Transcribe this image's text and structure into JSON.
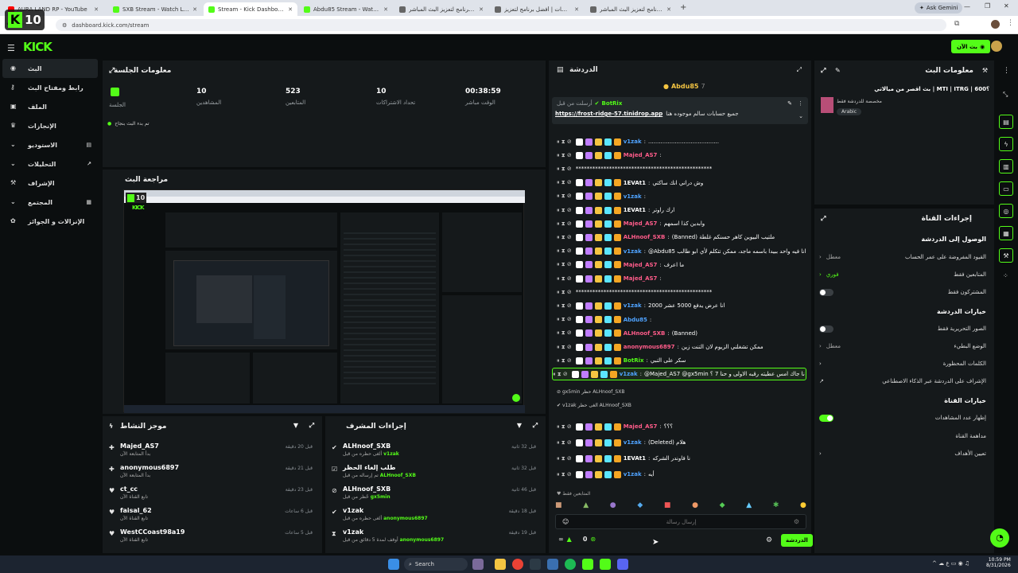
{
  "browser": {
    "tabs": [
      {
        "title": "AURA LAND RP - YouTube",
        "color": "#ff0000"
      },
      {
        "title": "SXB Stream - Watch Live on Kick",
        "color": "#53fc18"
      },
      {
        "title": "Stream - Kick Dashboard",
        "color": "#53fc18"
      },
      {
        "title": "Abdu85 Stream - Watch Live on Kick",
        "color": "#53fc18"
      },
      {
        "title": "أفضل برنامج لتعزيز البث المباشر",
        "color": "#666666"
      },
      {
        "title": "الوسيطات | أفضل برنامج لتعزيز",
        "color": "#666666"
      },
      {
        "title": "أفضل برنامج لتعزيز البث المباشر",
        "color": "#666666"
      }
    ],
    "new_tab": "+",
    "ask_gemini": "Ask Gemini",
    "url": "dashboard.kick.com/stream"
  },
  "topbar": {
    "logo": "KICK",
    "live_button": "بث الآن",
    "overlay_badge": "10"
  },
  "sidebar": {
    "items": [
      {
        "label": "البث",
        "icon": "broadcast-icon"
      },
      {
        "label": "رابط ومفتاح البث",
        "icon": "key-icon"
      },
      {
        "label": "الملف",
        "icon": "profile-icon"
      },
      {
        "label": "الإنجازات",
        "icon": "trophy-icon"
      },
      {
        "label": "الاستوديو",
        "icon": "studio-icon"
      },
      {
        "label": "التحليلات",
        "icon": "analytics-icon"
      },
      {
        "label": "الإشراف",
        "icon": "moderation-icon"
      },
      {
        "label": "المجتمع",
        "icon": "community-icon"
      },
      {
        "label": "الإنزالات و الجوائز",
        "icon": "drops-icon"
      }
    ]
  },
  "session": {
    "title": "معلومات الجلسة",
    "stats": [
      {
        "value": "00:38:59",
        "label": "الوقت مباشر"
      },
      {
        "value": "10",
        "label": "تحداد الاشتراكات"
      },
      {
        "value": "523",
        "label": "المتابعين"
      },
      {
        "value": "10",
        "label": "المشاهدين"
      }
    ],
    "live_label": "الجلسة",
    "status": "تم بدء البث بنجاح"
  },
  "preview": {
    "title": "مراجعة البث",
    "badge": "10"
  },
  "activity": {
    "title": "موجز النشاط",
    "items": [
      {
        "name": "Majed_AS7",
        "sub": "بدأ المتابعة الآن",
        "time": "قبل 20 دقيقة",
        "icon": "follow-icon"
      },
      {
        "name": "anonymous6897",
        "sub": "بدأ المتابعة الآن",
        "time": "قبل 21 دقيقة",
        "icon": "follow-icon"
      },
      {
        "name": "ct_cc",
        "sub": "تابع القناة الآن",
        "time": "قبل 23 دقيقة",
        "icon": "heart-icon"
      },
      {
        "name": "faisal_62",
        "sub": "تابع القناة الآن",
        "time": "قبل 6 ساعات",
        "icon": "heart-icon"
      },
      {
        "name": "WestCCoast98a19",
        "sub": "تابع القناة الآن",
        "time": "قبل 5 ساعات",
        "icon": "heart-icon"
      }
    ]
  },
  "modactions": {
    "title": "إجراءات المشرف",
    "items": [
      {
        "name": "ALHnoof_SXB",
        "sub": "ألغى حظره من قبل",
        "by": "v1zak",
        "time": "قبل 32 ثانية"
      },
      {
        "name": "طلب إلغاء الحظر",
        "sub": "تم إرساله من قبل",
        "by": "ALHnoof_SXB",
        "time": "قبل 32 ثانية"
      },
      {
        "name": "ALHnoof_SXB",
        "sub": "حُظر من قبل",
        "by": "gx5min",
        "time": "قبل 46 ثانية"
      },
      {
        "name": "v1zak",
        "sub": "ألغى حظره من قبل",
        "by": "anonymous6897",
        "time": "قبل 18 دقيقة"
      },
      {
        "name": "v1zak",
        "sub": "أوقف لمدة 5 دقائق من قبل",
        "by": "anonymous6897",
        "time": "قبل 19 دقيقة"
      }
    ]
  },
  "chat": {
    "title": "الدردشة",
    "host_user": "Abdu85",
    "pinned": {
      "by": "BotRix",
      "label": "أرسلت من قبل",
      "link": "https://frost-ridge-57.tinidrop.app",
      "text": "جميع حسابات سالم موجوده هنا"
    },
    "lines": [
      {
        "user": "v1zak",
        "color": "#4fa3ff",
        "text": "........................................"
      },
      {
        "user": "Majed_AS7",
        "color": "#ff5c8a",
        "text": ""
      },
      {
        "user": "",
        "color": "#ffffff",
        "text": "*************************************************"
      },
      {
        "user": "1EVAt1",
        "color": "#ffffff",
        "text": "وش دراني انك ساكتي"
      },
      {
        "user": "v1zak",
        "color": "#4fa3ff",
        "text": ""
      },
      {
        "user": "1EVAt1",
        "color": "#ffffff",
        "text": "ارك راوتر"
      },
      {
        "user": "Majed_AS7",
        "color": "#ff5c8a",
        "text": "وابدين كذا اسمهم"
      },
      {
        "user": "ALHnoof_SXB",
        "color": "#ff5c8a",
        "text": "(Banned) ملتيب البيوين كاهر حسنكم غلطة"
      },
      {
        "user": "v1zak",
        "color": "#4fa3ff",
        "text": "@Abdu85 انا فيه واحد ببيدا باسمه ماجد، ممكن تتكلم لأي ابو طالب"
      },
      {
        "user": "Majed_AS7",
        "color": "#ff5c8a",
        "text": "ما اعرف"
      },
      {
        "user": "Majed_AS7",
        "color": "#ff5c8a",
        "text": ""
      },
      {
        "user": "",
        "color": "#ffffff",
        "text": "*************************************************"
      },
      {
        "user": "v1zak",
        "color": "#4fa3ff",
        "text": "انا عرض يدفع 5000 عشر 2000"
      },
      {
        "user": "Abdu85",
        "color": "#4fa3ff",
        "text": ""
      },
      {
        "user": "ALHnoof_SXB",
        "color": "#ff5c8a",
        "text": "(Banned)"
      },
      {
        "user": "anonymous6897",
        "color": "#ff5c8a",
        "text": "ممكن تشغلني الزيوم لان التنت زين"
      },
      {
        "user": "BotRix",
        "color": "#53fc18",
        "text": "سكر على التبي"
      },
      {
        "user": "v1zak",
        "color": "#4fa3ff",
        "text": "@Majed_AS7 @gx5min نا جاك امس عطيته رقبه الاولى و حنا 7 ؟"
      }
    ],
    "system1": "gx5min حظر ALHnoof_SXB",
    "system2": "v1zak ألغى حظر ALHnoof_SXB",
    "lines2": [
      {
        "user": "Majed_AS7",
        "color": "#ff5c8a",
        "text": "؟؟؟"
      },
      {
        "user": "v1zak",
        "color": "#4fa3ff",
        "text": "(Deleted) هلام"
      },
      {
        "user": "1EVAt1",
        "color": "#ffffff",
        "text": "نا فاوندر الشركه"
      },
      {
        "user": "v1zak",
        "color": "#4fa3ff",
        "text": "أيه"
      }
    ],
    "followers_only": "المتابعين فقط",
    "input_placeholder": "إرسال رسالة",
    "send": "الدردشة",
    "count": "0"
  },
  "streaminfo": {
    "title": "معلومات البث",
    "stream_title": "بث اقصر من ميالاتي | MTI | ITRG | 600؟",
    "category": "مخصصة للدردشة فقط",
    "language": "Arabic"
  },
  "channel": {
    "title": "إجراءات القناة",
    "access_title": "الوصول إلى الدردشة",
    "access": [
      {
        "label": "القيود المفروضة على عمر الحساب",
        "value": "معطل"
      },
      {
        "label": "المتابعين فقط",
        "value": "فوري"
      },
      {
        "label": "المشتركون فقط",
        "value": "toggle-off"
      }
    ],
    "options_title": "خيارات الدردشة",
    "options": [
      {
        "label": "الصور التحريرية فقط",
        "value": "toggle-off"
      },
      {
        "label": "الوضع البطيء",
        "value": "معطل"
      },
      {
        "label": "الكلمات المحظورة",
        "value": ""
      },
      {
        "label": "الإشراف على الدردشة عبر الذكاء الاصطناعي",
        "value": ""
      }
    ],
    "channel_title": "خيارات القناة",
    "channel_opts": [
      {
        "label": "إظهار عدد المشاهدات",
        "value": "toggle-on"
      },
      {
        "label": "مداهمة القناة",
        "value": ""
      },
      {
        "label": "تعيين الأهداف",
        "value": ""
      }
    ]
  },
  "taskbar": {
    "search": "Search",
    "time": "10:59 PM",
    "date": "8/31/2026"
  },
  "colors": {
    "brand": "#53fc18",
    "bg": "#0b0e0f",
    "panel": "#15191b"
  }
}
